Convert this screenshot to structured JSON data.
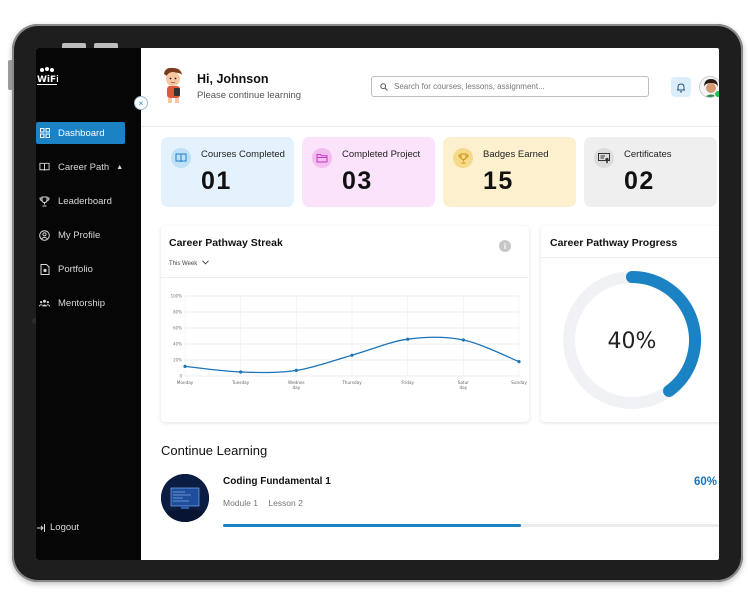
{
  "app": {
    "logo_text": "WiFi"
  },
  "sidebar": {
    "items": [
      {
        "label": "Dashboard",
        "icon": "dashboard-icon",
        "active": true
      },
      {
        "label": "Career Path",
        "icon": "book-icon",
        "active": false
      },
      {
        "label": "Leaderboard",
        "icon": "trophy-icon",
        "active": false
      },
      {
        "label": "My Profile",
        "icon": "user-circle-icon",
        "active": false
      },
      {
        "label": "Portfolio",
        "icon": "document-icon",
        "active": false
      },
      {
        "label": "Mentorship",
        "icon": "group-icon",
        "active": false
      }
    ],
    "logout_label": "Logout"
  },
  "header": {
    "greeting": "Hi, Johnson",
    "subtitle": "Please continue learning",
    "search_placeholder": "Search for courses, lessons, assignment..."
  },
  "stats": [
    {
      "label": "Courses Completed",
      "value": "01",
      "bg": "#e3f2fd",
      "icon_bg": "#bfe0f7",
      "icon": "book-icon",
      "icon_color": "#1b82c4"
    },
    {
      "label": "Completed Project",
      "value": "03",
      "bg": "#fbe3fb",
      "icon_bg": "#f3bdf2",
      "icon": "folder-icon",
      "icon_color": "#c23bc0"
    },
    {
      "label": "Badges Earned",
      "value": "15",
      "bg": "#fdf0cf",
      "icon_bg": "#f6d98a",
      "icon": "trophy-icon",
      "icon_color": "#c99411"
    },
    {
      "label": "Certificates",
      "value": "02",
      "bg": "#efefef",
      "icon_bg": "#dcdcdc",
      "icon": "certificate-icon",
      "icon_color": "#333333"
    }
  ],
  "streak": {
    "title": "Career Pathway Streak",
    "filter": "This Week"
  },
  "progress_card": {
    "title": "Career Pathway Progress",
    "percent_label": "40%",
    "fraction": 0.4
  },
  "continue": {
    "title": "Continue Learning",
    "course_name": "Coding Fundamental 1",
    "module": "Module 1",
    "lesson": "Lesson 2",
    "percent_label": "60%",
    "fraction": 0.6
  },
  "chart_data": {
    "type": "line",
    "categories": [
      "Monday",
      "Tuesday",
      "Wednesday",
      "Thursday",
      "Friday",
      "Saturday",
      "Sunday"
    ],
    "category_labels": [
      [
        "Monday"
      ],
      [
        "Tuesday"
      ],
      [
        "Wednes",
        "day"
      ],
      [
        "Thursday"
      ],
      [
        "Friday"
      ],
      [
        "Satur",
        "day"
      ],
      [
        "Sunday"
      ]
    ],
    "values": [
      12,
      5,
      7,
      26,
      46,
      45,
      18
    ],
    "ylim": [
      0,
      100
    ],
    "y_ticks": [
      "0",
      "20%",
      "40%",
      "60%",
      "80%",
      "100%"
    ],
    "color": "#1b73b8",
    "grid": true
  }
}
